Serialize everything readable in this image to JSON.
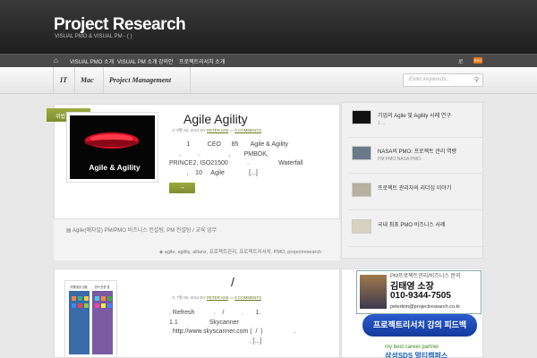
{
  "header": {
    "site_title": "Project Research",
    "tagline": "VISUAL PMO & VISUAL PM      -      ( )"
  },
  "topnav": {
    "items": [
      "VISUAL PMO 소개",
      "VISUAL PM 소개",
      "강의안",
      "프로젝트리서치 소개"
    ],
    "right_link": "로"
  },
  "categories": [
    "IT",
    "Mac",
    "Project Management"
  ],
  "search": {
    "placeholder": "Enter keywords..."
  },
  "post1": {
    "badge": "위법",
    "image_caption": "Agile & Agility",
    "title": "Agile    Agility",
    "date": "9월 25, 2014 BY",
    "author": "PETER KIM",
    "comments": "0 COMMENTS",
    "excerpt": "          1          CEO      85       Agile & Agility\n      .          .                ,        PMBOK,\nPRINCE2, ISO21500           .                 Waterfall\n          ,    10     Agile              [...]",
    "more": "→",
    "category_line": "Agile(애자일)    PM/PMO 비즈니스 컨설팅, PM 컨설팅 / 교육 업무",
    "tags": "agile, agility, allianz, 프로젝트관리, 프로젝트리서치, PMO, projectresearch"
  },
  "post2": {
    "image_top_left": "여행/출장 공통",
    "image_top_right": "현지 전문 앱",
    "title": "/",
    "date": "7월 06, 2014 BY",
    "author": "PETER KIM",
    "comments": "0 COMMENTS",
    "excerpt": ". Refresh           .    /          .       1.\n1.1                  Skycanner\n. http://www.skyscanner.com (  /  )                  .\n                                              . [...]"
  },
  "sidebar": [
    {
      "title": "기업의 Agile 및 Agility 사례 연구",
      "sub": "          1 ..."
    },
    {
      "title": "NASA의 PMO: 프로젝트 관리 역량",
      "sub": "PM    PMO      NASA   PMO:        ."
    },
    {
      "title": "프로젝트 관리자의 리더십 이야기",
      "sub": ""
    },
    {
      "title": "국내 최초 PMO 비즈니스 사례",
      "sub": ""
    }
  ],
  "widget": {
    "line1": "PM프로젝트관리/비즈니스 문의",
    "name": "김태영 소장",
    "phone": "010-9344-7505",
    "email": "peterkim@projectresearch.co.kr",
    "button": "프로젝트리서치 강의 피드백",
    "partner1": "my best career partner",
    "partner2": "삼성SDS 멀티캠퍼스"
  },
  "colors": {
    "accent": "#8a9a32",
    "header_bg": "#2a2a2a",
    "nav_bg": "#4a4a4a"
  }
}
